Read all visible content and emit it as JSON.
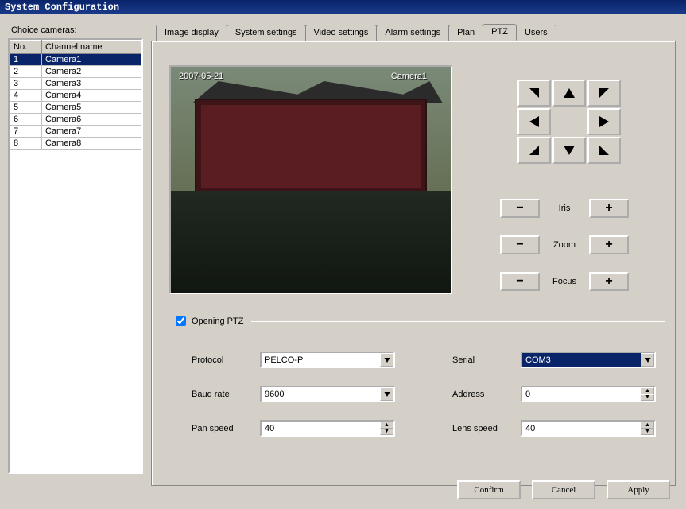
{
  "window": {
    "title": "System Configuration"
  },
  "sidebar": {
    "label": "Choice cameras:",
    "columns": {
      "no": "No.",
      "name": "Channel name"
    },
    "cameras": [
      {
        "no": "1",
        "name": "Camera1",
        "selected": true
      },
      {
        "no": "2",
        "name": "Camera2"
      },
      {
        "no": "3",
        "name": "Camera3"
      },
      {
        "no": "4",
        "name": "Camera4"
      },
      {
        "no": "5",
        "name": "Camera5"
      },
      {
        "no": "6",
        "name": "Camera6"
      },
      {
        "no": "7",
        "name": "Camera7"
      },
      {
        "no": "8",
        "name": "Camera8"
      }
    ]
  },
  "tabs": [
    {
      "label": "Image display"
    },
    {
      "label": "System settings"
    },
    {
      "label": "Video settings"
    },
    {
      "label": "Alarm settings"
    },
    {
      "label": "Plan"
    },
    {
      "label": "PTZ",
      "active": true
    },
    {
      "label": "Users"
    }
  ],
  "preview": {
    "overlay_date": "2007-05-21",
    "overlay_camera": "Camera1"
  },
  "ptz_directions": {
    "nw": "up-left",
    "n": "up",
    "ne": "up-right",
    "w": "left",
    "center": "",
    "e": "right",
    "sw": "down-left",
    "s": "down",
    "se": "down-right"
  },
  "lens": {
    "minus": "−",
    "plus": "+",
    "iris_label": "Iris",
    "zoom_label": "Zoom",
    "focus_label": "Focus"
  },
  "checkbox": {
    "label": "Opening PTZ",
    "checked": true
  },
  "form": {
    "protocol_label": "Protocol",
    "protocol_value": "PELCO-P",
    "serial_label": "Serial",
    "serial_value": "COM3",
    "baud_label": "Baud rate",
    "baud_value": "9600",
    "address_label": "Address",
    "address_value": "0",
    "panspeed_label": "Pan speed",
    "panspeed_value": "40",
    "lensspeed_label": "Lens speed",
    "lensspeed_value": "40"
  },
  "buttons": {
    "confirm": "Confirm",
    "cancel": "Cancel",
    "apply": "Apply"
  }
}
